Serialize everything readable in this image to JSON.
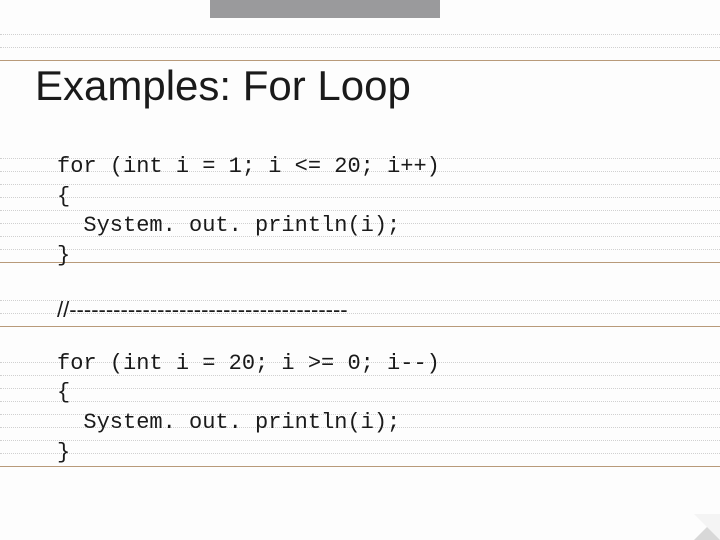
{
  "title": "Examples: For Loop",
  "code1": "for (int i = 1; i <= 20; i++)\n{\n  System. out. println(i);\n}",
  "separator": "//--------------------------------------",
  "code2": "for (int i = 20; i >= 0; i--)\n{\n  System. out. println(i);\n}"
}
